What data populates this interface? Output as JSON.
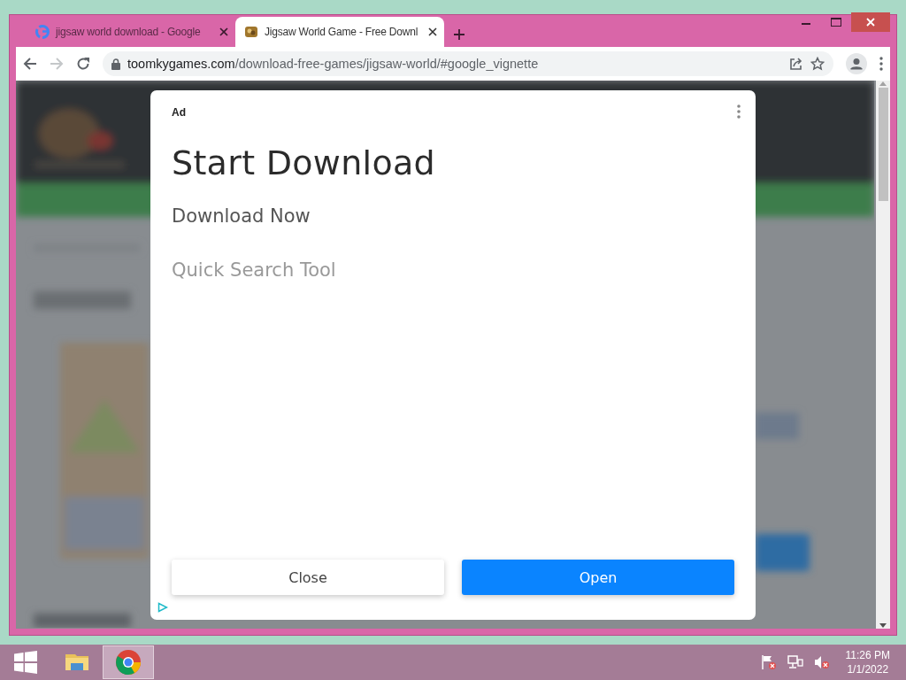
{
  "browser": {
    "tabs": [
      {
        "title": "jigsaw world download - Google",
        "kind": "search",
        "selected": false
      },
      {
        "title": "Jigsaw World Game - Free Downl",
        "kind": "site",
        "selected": true
      }
    ],
    "address": {
      "host": "toomkygames.com",
      "path": "/download-free-games/jigsaw-world/#google_vignette"
    }
  },
  "ad": {
    "badge": "Ad",
    "headline": "Start Download",
    "lines": [
      "Download Now",
      "Quick Search Tool"
    ],
    "buttons": [
      {
        "label": "Close",
        "kind": "secondary"
      },
      {
        "label": "Open",
        "kind": "primary"
      }
    ]
  },
  "taskbar": {
    "apps": [
      {
        "kind": "explorer",
        "selected": false
      },
      {
        "kind": "chrome",
        "selected": true
      }
    ],
    "clock": {
      "time": "11:26 PM",
      "date": "1/1/2022"
    }
  }
}
